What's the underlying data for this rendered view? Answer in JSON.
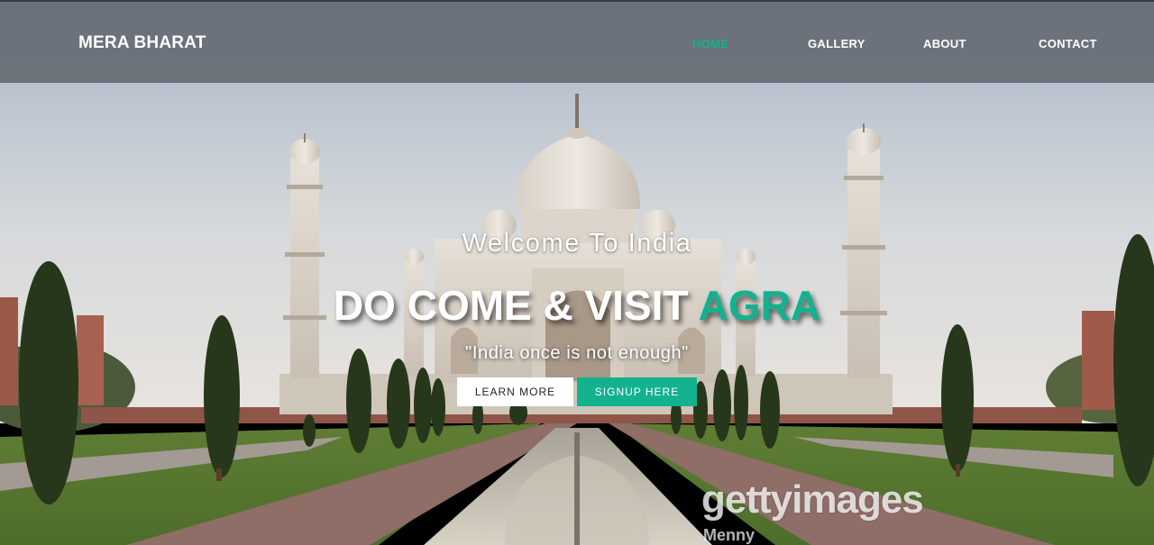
{
  "brand": "MERA BHARAT",
  "nav": {
    "home": "HOME",
    "gallery": "GALLERY",
    "about": "ABOUT",
    "contact": "CONTACT"
  },
  "hero": {
    "welcome": "Welcome To India",
    "headline_main": "DO COME & VISIT ",
    "headline_accent": "AGRA",
    "tagline": "\"India once is not enough\"",
    "learn_more": "LEARN MORE",
    "signup": "SIGNUP HERE"
  },
  "watermark": {
    "text": "gettyimages",
    "sub": "Menny"
  },
  "colors": {
    "accent": "#12b28f",
    "navbar": "#626870"
  },
  "background_image": "taj-mahal-photo"
}
